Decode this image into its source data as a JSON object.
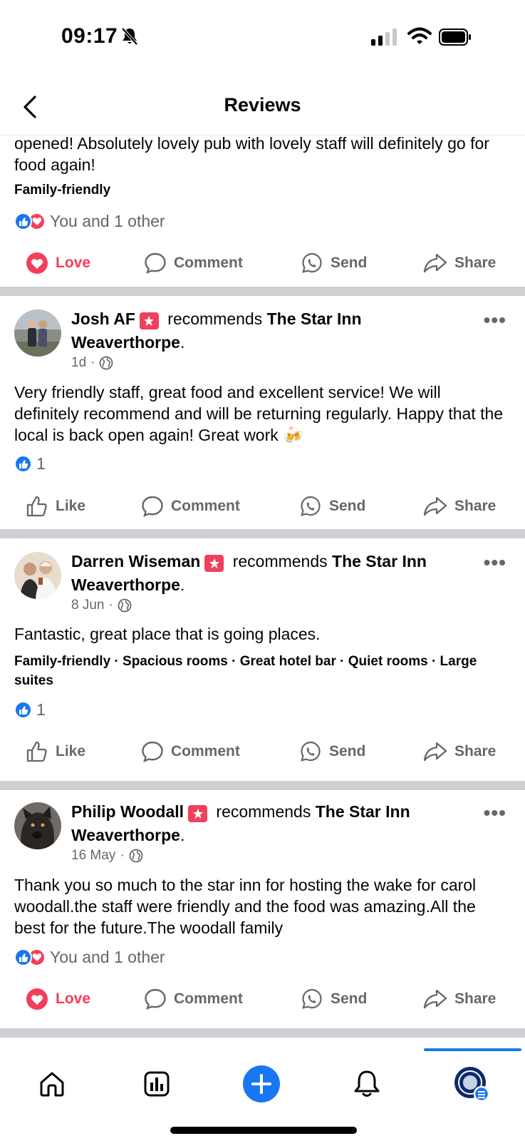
{
  "status": {
    "time": "09:17"
  },
  "header": {
    "title": "Reviews"
  },
  "posts": [
    {
      "text": "opened! Absolutely lovely pub with lovely staff will definitely go for food again!",
      "tags": "Family-friendly",
      "reactions_text": "You and 1 other",
      "actions": {
        "react": "Love",
        "comment": "Comment",
        "send": "Send",
        "share": "Share"
      }
    },
    {
      "user": "Josh AF",
      "recommends": "recommends",
      "page": "The Star Inn Weaverthorpe",
      "date": "1d",
      "text": "Very friendly staff, great food and excellent service! We will definitely recommend and will be returning regularly. Happy that the local is back open again! Great work 🍻",
      "reactions_text": "1",
      "actions": {
        "react": "Like",
        "comment": "Comment",
        "send": "Send",
        "share": "Share"
      }
    },
    {
      "user": "Darren Wiseman",
      "recommends": "recommends",
      "page": "The Star Inn Weaverthorpe",
      "date": "8 Jun",
      "text": "Fantastic, great place that is going places.",
      "tags": "Family-friendly · Spacious rooms · Great hotel bar · Quiet rooms · Large suites",
      "reactions_text": "1",
      "actions": {
        "react": "Like",
        "comment": "Comment",
        "send": "Send",
        "share": "Share"
      }
    },
    {
      "user": "Philip Woodall",
      "recommends": "recommends",
      "page": "The Star Inn Weaverthorpe",
      "date": "16 May",
      "text": "Thank you so much to the star inn for hosting the wake for carol woodall.the staff were friendly and the food was amazing.All the best for the future.The woodall family",
      "reactions_text": "You and 1 other",
      "actions": {
        "react": "Love",
        "comment": "Comment",
        "send": "Send",
        "share": "Share"
      }
    }
  ],
  "nav": {
    "items": [
      "home-icon",
      "dashboard-icon",
      "create-icon",
      "notifications-icon",
      "profile-icon"
    ],
    "active": "profile-icon"
  },
  "colors": {
    "accent": "#1877f2",
    "love": "#f33e58",
    "secondary_text": "#65676b",
    "divider": "#ced0d4"
  }
}
